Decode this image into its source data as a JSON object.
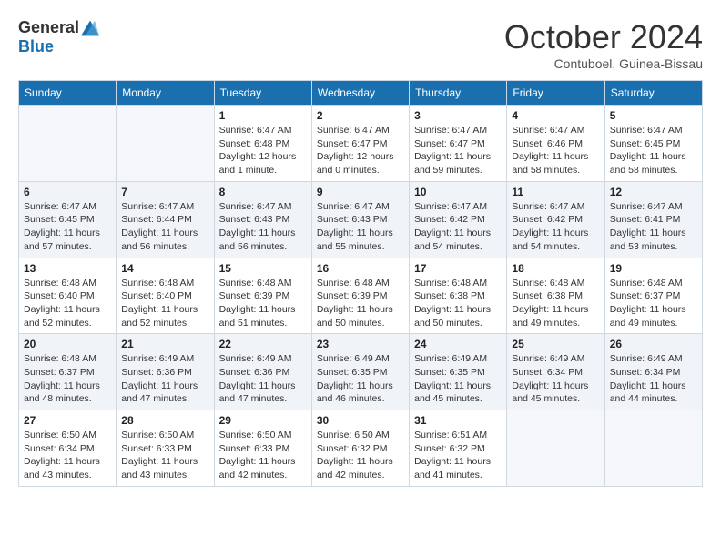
{
  "logo": {
    "general": "General",
    "blue": "Blue"
  },
  "title": "October 2024",
  "subtitle": "Contuboel, Guinea-Bissau",
  "days_header": [
    "Sunday",
    "Monday",
    "Tuesday",
    "Wednesday",
    "Thursday",
    "Friday",
    "Saturday"
  ],
  "weeks": [
    [
      {
        "day": "",
        "info": ""
      },
      {
        "day": "",
        "info": ""
      },
      {
        "day": "1",
        "info": "Sunrise: 6:47 AM\nSunset: 6:48 PM\nDaylight: 12 hours and 1 minute."
      },
      {
        "day": "2",
        "info": "Sunrise: 6:47 AM\nSunset: 6:47 PM\nDaylight: 12 hours and 0 minutes."
      },
      {
        "day": "3",
        "info": "Sunrise: 6:47 AM\nSunset: 6:47 PM\nDaylight: 11 hours and 59 minutes."
      },
      {
        "day": "4",
        "info": "Sunrise: 6:47 AM\nSunset: 6:46 PM\nDaylight: 11 hours and 58 minutes."
      },
      {
        "day": "5",
        "info": "Sunrise: 6:47 AM\nSunset: 6:45 PM\nDaylight: 11 hours and 58 minutes."
      }
    ],
    [
      {
        "day": "6",
        "info": "Sunrise: 6:47 AM\nSunset: 6:45 PM\nDaylight: 11 hours and 57 minutes."
      },
      {
        "day": "7",
        "info": "Sunrise: 6:47 AM\nSunset: 6:44 PM\nDaylight: 11 hours and 56 minutes."
      },
      {
        "day": "8",
        "info": "Sunrise: 6:47 AM\nSunset: 6:43 PM\nDaylight: 11 hours and 56 minutes."
      },
      {
        "day": "9",
        "info": "Sunrise: 6:47 AM\nSunset: 6:43 PM\nDaylight: 11 hours and 55 minutes."
      },
      {
        "day": "10",
        "info": "Sunrise: 6:47 AM\nSunset: 6:42 PM\nDaylight: 11 hours and 54 minutes."
      },
      {
        "day": "11",
        "info": "Sunrise: 6:47 AM\nSunset: 6:42 PM\nDaylight: 11 hours and 54 minutes."
      },
      {
        "day": "12",
        "info": "Sunrise: 6:47 AM\nSunset: 6:41 PM\nDaylight: 11 hours and 53 minutes."
      }
    ],
    [
      {
        "day": "13",
        "info": "Sunrise: 6:48 AM\nSunset: 6:40 PM\nDaylight: 11 hours and 52 minutes."
      },
      {
        "day": "14",
        "info": "Sunrise: 6:48 AM\nSunset: 6:40 PM\nDaylight: 11 hours and 52 minutes."
      },
      {
        "day": "15",
        "info": "Sunrise: 6:48 AM\nSunset: 6:39 PM\nDaylight: 11 hours and 51 minutes."
      },
      {
        "day": "16",
        "info": "Sunrise: 6:48 AM\nSunset: 6:39 PM\nDaylight: 11 hours and 50 minutes."
      },
      {
        "day": "17",
        "info": "Sunrise: 6:48 AM\nSunset: 6:38 PM\nDaylight: 11 hours and 50 minutes."
      },
      {
        "day": "18",
        "info": "Sunrise: 6:48 AM\nSunset: 6:38 PM\nDaylight: 11 hours and 49 minutes."
      },
      {
        "day": "19",
        "info": "Sunrise: 6:48 AM\nSunset: 6:37 PM\nDaylight: 11 hours and 49 minutes."
      }
    ],
    [
      {
        "day": "20",
        "info": "Sunrise: 6:48 AM\nSunset: 6:37 PM\nDaylight: 11 hours and 48 minutes."
      },
      {
        "day": "21",
        "info": "Sunrise: 6:49 AM\nSunset: 6:36 PM\nDaylight: 11 hours and 47 minutes."
      },
      {
        "day": "22",
        "info": "Sunrise: 6:49 AM\nSunset: 6:36 PM\nDaylight: 11 hours and 47 minutes."
      },
      {
        "day": "23",
        "info": "Sunrise: 6:49 AM\nSunset: 6:35 PM\nDaylight: 11 hours and 46 minutes."
      },
      {
        "day": "24",
        "info": "Sunrise: 6:49 AM\nSunset: 6:35 PM\nDaylight: 11 hours and 45 minutes."
      },
      {
        "day": "25",
        "info": "Sunrise: 6:49 AM\nSunset: 6:34 PM\nDaylight: 11 hours and 45 minutes."
      },
      {
        "day": "26",
        "info": "Sunrise: 6:49 AM\nSunset: 6:34 PM\nDaylight: 11 hours and 44 minutes."
      }
    ],
    [
      {
        "day": "27",
        "info": "Sunrise: 6:50 AM\nSunset: 6:34 PM\nDaylight: 11 hours and 43 minutes."
      },
      {
        "day": "28",
        "info": "Sunrise: 6:50 AM\nSunset: 6:33 PM\nDaylight: 11 hours and 43 minutes."
      },
      {
        "day": "29",
        "info": "Sunrise: 6:50 AM\nSunset: 6:33 PM\nDaylight: 11 hours and 42 minutes."
      },
      {
        "day": "30",
        "info": "Sunrise: 6:50 AM\nSunset: 6:32 PM\nDaylight: 11 hours and 42 minutes."
      },
      {
        "day": "31",
        "info": "Sunrise: 6:51 AM\nSunset: 6:32 PM\nDaylight: 11 hours and 41 minutes."
      },
      {
        "day": "",
        "info": ""
      },
      {
        "day": "",
        "info": ""
      }
    ]
  ]
}
